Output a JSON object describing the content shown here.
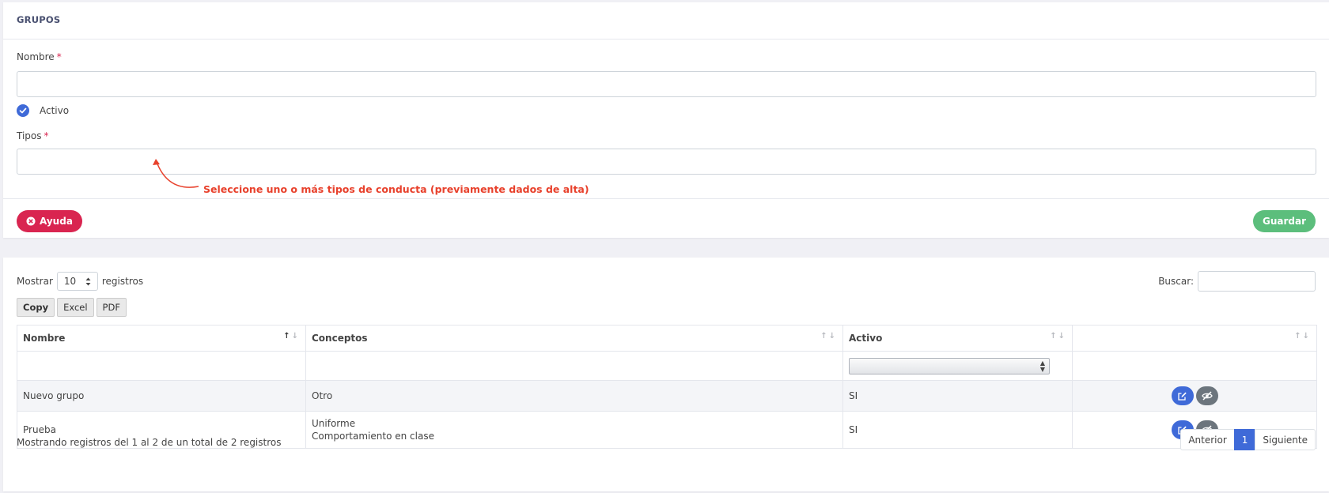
{
  "form": {
    "title": "GRUPOS",
    "nombre_label": "Nombre",
    "nombre_value": "",
    "required_mark": "*",
    "activo_label": "Activo",
    "activo_checked": true,
    "tipos_label": "Tipos",
    "tipos_value": "",
    "hint_text": "Seleccione uno o más tipos de conducta (previamente dados de alta)",
    "help_button": "Ayuda",
    "save_button": "Guardar"
  },
  "table_controls": {
    "show_label": "Mostrar",
    "page_length": "10",
    "records_label": "registros",
    "search_label": "Buscar:",
    "search_value": "",
    "export_buttons": [
      "Copy",
      "Excel",
      "PDF"
    ]
  },
  "table": {
    "headers": [
      "Nombre",
      "Conceptos",
      "Activo",
      ""
    ],
    "sort_arrows": "↑↓",
    "filter_activo": "",
    "rows": [
      {
        "nombre": "Nuevo grupo",
        "conceptos": [
          "Otro"
        ],
        "activo": "SI"
      },
      {
        "nombre": "Prueba",
        "conceptos": [
          "Uniforme",
          "Comportamiento en clase"
        ],
        "activo": "SI"
      }
    ]
  },
  "footer": {
    "info": "Mostrando registros del 1 al 2 de un total de 2 registros",
    "prev": "Anterior",
    "current_page": "1",
    "next": "Siguiente"
  },
  "colors": {
    "primary": "#3f6ad8",
    "danger": "#d92550",
    "success": "#5cbe7c",
    "hint": "#e8412c",
    "secondary": "#6c757d"
  }
}
